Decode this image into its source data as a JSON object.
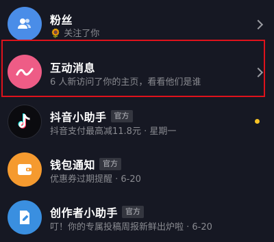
{
  "colors": {
    "background": "#161823",
    "fans_avatar": "#4a8de8",
    "interaction_avatar": "#ee5c86",
    "douyin_avatar": "#0b0b0f",
    "wallet_avatar": "#f59a2f",
    "creator_avatar": "#3a8fe0",
    "highlight_border": "#e0121b",
    "unread_dot": "#f7c325"
  },
  "rows": [
    {
      "title": "粉丝",
      "subtitle_icon": "sunflower-icon",
      "subtitle": "关注了你",
      "avatar_icon": "users-icon",
      "trailing": "chevron-right-icon"
    },
    {
      "title": "互动消息",
      "subtitle": "6 人新访问了你的主页，看看他们是谁",
      "avatar_icon": "wave-icon",
      "trailing": "chevron-right-icon",
      "highlighted": true
    },
    {
      "title": "抖音小助手",
      "tag": "官方",
      "subtitle": "抖音支付最高减11.8元 · 星期一",
      "avatar_icon": "douyin-logo-icon",
      "trailing": "unread-dot"
    },
    {
      "title": "钱包通知",
      "tag": "官方",
      "subtitle": "优惠券过期提醒 · 6-20",
      "avatar_icon": "wallet-icon"
    },
    {
      "title": "创作者小助手",
      "tag": "官方",
      "subtitle": "叮！你的专属投稿周报新鲜出炉啦 · 6-20",
      "avatar_icon": "edit-icon"
    }
  ]
}
